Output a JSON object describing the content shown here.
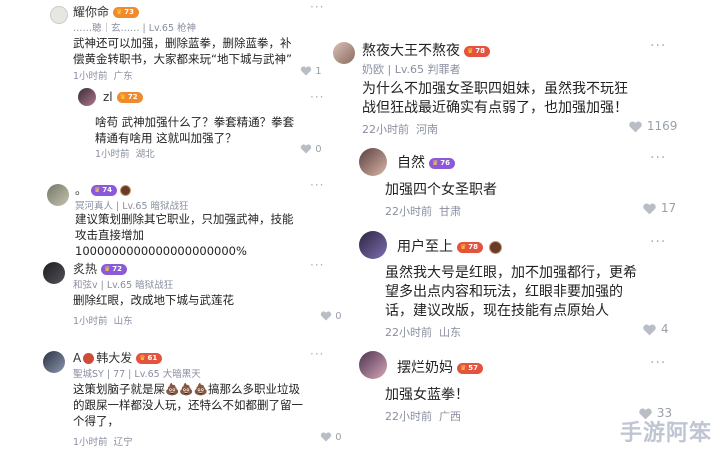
{
  "left": {
    "c1": {
      "username": "耀你命",
      "level_badge": "73",
      "meta": "……聴｜玄…… | Lv.65 枪神",
      "body": "武神还可以加强，删除蓝拳，删除蓝拳，补偿黄金转职书，大家都来玩“地下城与武神”",
      "time": "1小时前",
      "region": "广东",
      "likes": "1",
      "reply": {
        "username": "zl",
        "level_badge": "72",
        "body": "啥苟 武神加强什么了？拳套精通？拳套精通有啥用 这就叫加强了？",
        "time": "1小时前",
        "region": "湖北",
        "likes": "0"
      }
    },
    "c2": {
      "username": "。",
      "level_badge": "74",
      "meta": "冥河真人 | Lv.65 暗狱战狂",
      "body": "建议策划删除其它职业，只加强武神，技能攻击直接增加1000000000000000000000%",
      "time": "1小时前",
      "region": "山东",
      "likes": "0"
    },
    "c3": {
      "username": "炙热",
      "level_badge": "72",
      "meta": "和弦v | Lv.65 暗狱战狂",
      "body": "删除红眼，改成地下城与武莲花",
      "time": "1小时前",
      "region": "山东",
      "likes": "0"
    },
    "c4": {
      "username": "A",
      "username_suffix": "韩大发",
      "level_badge": "61",
      "meta": "聖城SY | 77 | Lv.65 大暗黑天",
      "body": "这策划脑子就是屎💩💩💩搞那么多职业垃圾的跟屎一样都没人玩，还特么不如都删了留一个得了，",
      "time": "1小时前",
      "region": "辽宁",
      "likes": "0"
    }
  },
  "right": {
    "c1": {
      "username": "熬夜大王不熬夜",
      "level_badge": "78",
      "meta": "奶欧 | Lv.65 判罪者",
      "body": "为什么不加强女圣职四姐妹，虽然我不玩狂战但狂战最近确实有点弱了，也加强加强！",
      "time": "22小时前",
      "region": "河南",
      "likes": "1169"
    },
    "c2": {
      "username": "自然",
      "level_badge": "76",
      "body": "加强四个女圣职者",
      "time": "22小时前",
      "region": "甘肃",
      "likes": "17"
    },
    "c3": {
      "username": "用户至上",
      "level_badge": "78",
      "body": "虽然我大号是红眼，加不加强都行，更希望多出点内容和玩法，红眼非要加强的话，建议改版，现在技能有点原始人",
      "time": "22小时前",
      "region": "山东",
      "likes": "4"
    },
    "c4": {
      "username": "摆烂奶妈",
      "level_badge": "57",
      "body": "加强女蓝拳！",
      "time": "22小时前",
      "region": "广西",
      "likes": "33"
    }
  },
  "more_icon": "···",
  "watermark": "手游阿笨",
  "colors": {
    "badge_orange": "#f08a2c",
    "badge_red": "#e4533d",
    "badge_purple": "#8c5ad8",
    "meta_gray": "#8a8fa0"
  }
}
